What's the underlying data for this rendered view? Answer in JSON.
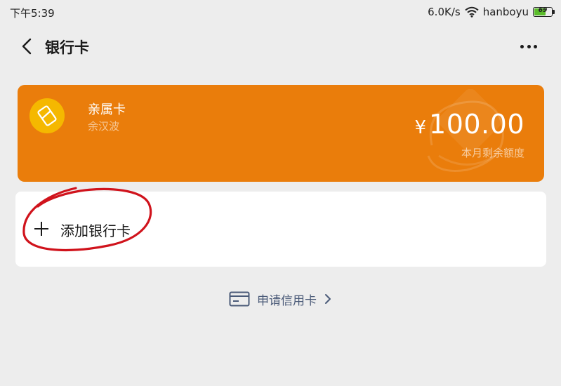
{
  "status_bar": {
    "time": "下午5:39",
    "network_speed": "6.0K/s",
    "wifi_name": "hanboyu",
    "battery_level": "69",
    "battery_fraction": 0.69
  },
  "header": {
    "title": "银行卡"
  },
  "family_card": {
    "name": "亲属卡",
    "holder": "余汉波",
    "currency": "¥",
    "amount": "100.00",
    "amount_label": "本月剩余额度",
    "background_color": "#ea7d0b",
    "logo_color": "#f5b800"
  },
  "add_card": {
    "label": "添加银行卡"
  },
  "apply_credit": {
    "label": "申请信用卡"
  },
  "icons": [
    "back-arrow-icon",
    "more-dots-icon",
    "wifi-icon",
    "battery-icon",
    "family-card-logo-icon",
    "plus-icon",
    "credit-card-icon",
    "chevron-right-icon"
  ],
  "colors": {
    "page_background": "#ededed",
    "link_text": "#4a5a78",
    "annotation": "#d0131c"
  }
}
